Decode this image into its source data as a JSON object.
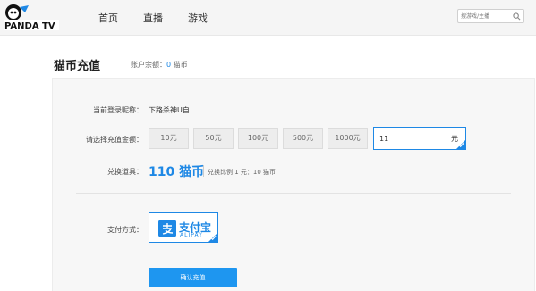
{
  "header": {
    "logo_text": "PANDA TV",
    "nav": [
      "首页",
      "直播",
      "游戏"
    ],
    "search_placeholder": "搜游戏/主播"
  },
  "page": {
    "title": "猫币充值",
    "balance_label": "账户余额：",
    "balance_value": "0",
    "balance_unit": " 猫币"
  },
  "form": {
    "nickname_label": "当前登录昵称：",
    "nickname_value": "下路杀神U自",
    "amount_label": "请选择充值金额：",
    "amounts": [
      "10元",
      "50元",
      "100元",
      "500元",
      "1000元"
    ],
    "custom_amount_value": "11",
    "custom_amount_unit": "元",
    "exchange_label": "兑换道具：",
    "exchange_amount": "110 猫币",
    "exchange_ratio": "兑换比例 1 元：10 猫币",
    "payment_label": "支付方式：",
    "payment_option_cn": "支付宝",
    "payment_option_en": "ALIPAY",
    "submit_label": "确认充值"
  },
  "colors": {
    "accent": "#1e88e5",
    "button": "#1e96f0"
  }
}
